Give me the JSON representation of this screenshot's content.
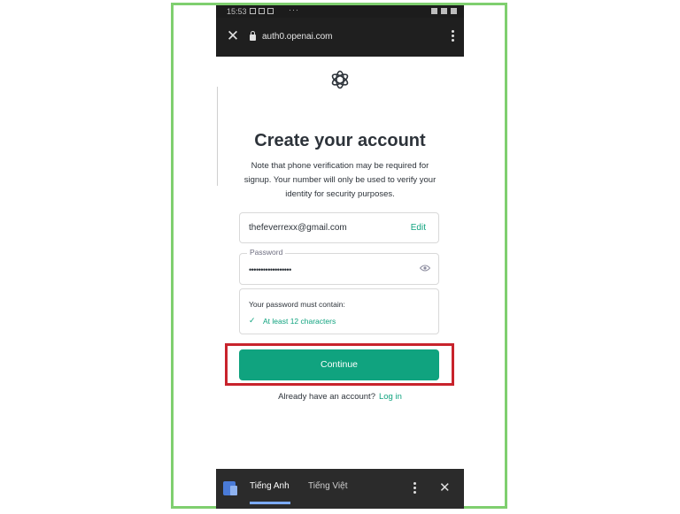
{
  "status_bar": {
    "time": "15:53",
    "dots": "···"
  },
  "browser": {
    "url": "auth0.openai.com",
    "close_glyph": "✕"
  },
  "page": {
    "title": "Create your account",
    "description": "Note that phone verification may be required for signup. Your number will only be used to verify your identity for security purposes."
  },
  "form": {
    "email_value": "thefeverrexx@gmail.com",
    "edit_label": "Edit",
    "password_label": "Password",
    "password_value": "••••••••••••••••••",
    "requirements_heading": "Your password must contain:",
    "requirement_check": "✓",
    "requirement_1": "At least 12 characters",
    "continue_label": "Continue",
    "login_prompt": "Already have an account?",
    "login_link": "Log in"
  },
  "translate_bar": {
    "tab_active": "Tiếng Anh",
    "tab_other": "Tiếng Việt",
    "close_glyph": "✕"
  },
  "colors": {
    "accent": "#10a37f",
    "highlight": "#c8232c",
    "frame": "#7fcf6f"
  },
  "icons": [
    "lock-icon",
    "openai-logo-icon",
    "eye-icon",
    "google-translate-icon",
    "more-vert-icon",
    "close-icon"
  ]
}
